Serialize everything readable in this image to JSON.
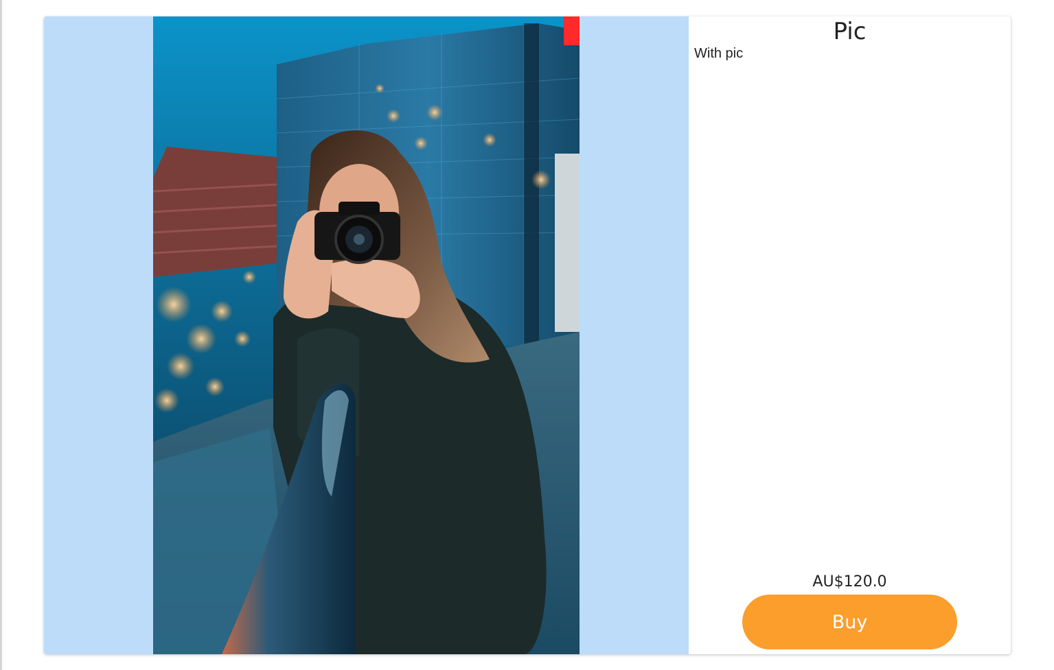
{
  "product": {
    "title": "Pic",
    "description": "With pic",
    "price": "AU$120.0",
    "buy_label": "Buy",
    "image_alt": "woman photographing with camera at dusk in city"
  },
  "colors": {
    "media_background": "#bcdcfa",
    "buy_button": "#fb9e2c"
  }
}
